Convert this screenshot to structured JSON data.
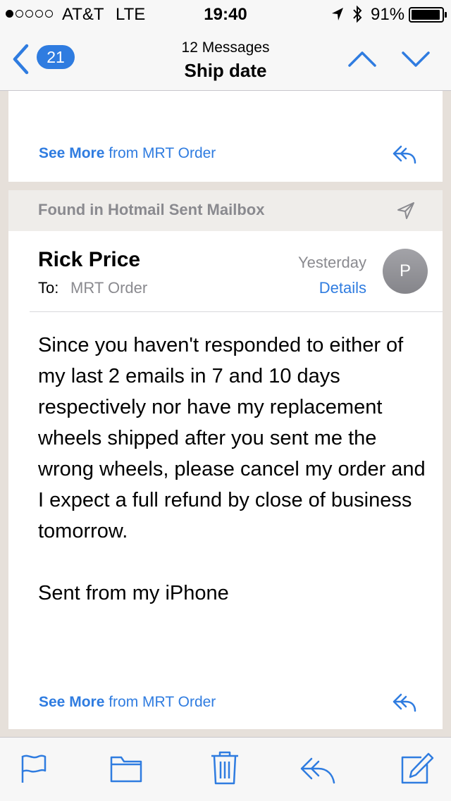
{
  "status_bar": {
    "carrier": "AT&T",
    "network": "LTE",
    "time": "19:40",
    "battery": "91%",
    "icons": [
      "signal-dots",
      "location-arrow-icon",
      "bluetooth-icon",
      "battery-icon"
    ]
  },
  "nav": {
    "back_count": "21",
    "message_count": "12 Messages",
    "subject": "Ship date"
  },
  "previous_card": {
    "see_more_bold": "See More",
    "see_more_rest": "from MRT Order"
  },
  "found_banner": {
    "text": "Found in Hotmail Sent Mailbox"
  },
  "message": {
    "sender": "Rick Price",
    "to_label": "To:",
    "to_value": "MRT Order",
    "date": "Yesterday",
    "details_label": "Details",
    "avatar_initial": "P",
    "body": "Since you haven't responded to either of my last 2 emails in 7 and 10 days respectively nor have my replacement wheels shipped after you sent me the wrong wheels, please cancel my order and I expect a full refund by close of business tomorrow.\n\nSent from my iPhone",
    "see_more_bold": "See More",
    "see_more_rest": "from MRT Order"
  },
  "toolbar": {
    "icons": [
      "flag-icon",
      "folder-icon",
      "trash-icon",
      "reply-icon",
      "compose-icon"
    ]
  },
  "colors": {
    "accent": "#2f7ce0",
    "secondary_text": "#8a8a8f",
    "background": "#e6e0da"
  }
}
